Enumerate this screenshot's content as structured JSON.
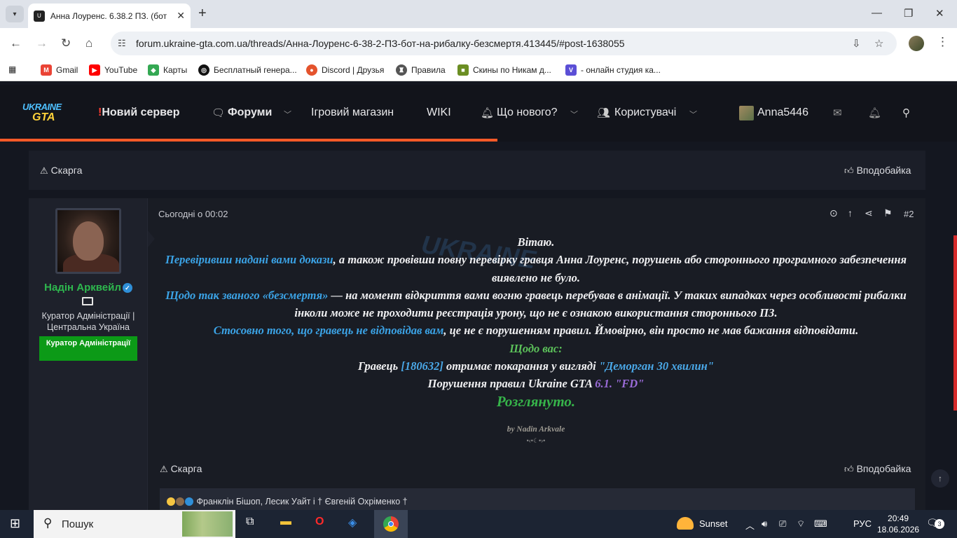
{
  "browser": {
    "tab_title": "Анна Лоуренс. 6.38.2 ПЗ. (бот",
    "url": "forum.ukraine-gta.com.ua/threads/Анна-Лоуренс-6-38-2-ПЗ-бот-на-рибалку-безсмертя.413445/#post-1638055",
    "bookmarks": [
      {
        "label": "Gmail",
        "color": "#ea4335",
        "icon": "gmail-icon"
      },
      {
        "label": "YouTube",
        "color": "#ff0000",
        "icon": "youtube-icon"
      },
      {
        "label": "Карты",
        "color": "#34a853",
        "icon": "maps-icon"
      },
      {
        "label": "Бесплатный генера...",
        "color": "#111111",
        "icon": "target-icon"
      },
      {
        "label": "Discord | Друзья",
        "color": "#e4532d",
        "icon": "discord-icon"
      },
      {
        "label": "Правила",
        "color": "#555555",
        "icon": "shield-icon"
      },
      {
        "label": "Скины по Никам д...",
        "color": "#6b8e23",
        "icon": "minecraft-icon"
      },
      {
        "label": "- онлайн студия ка...",
        "color": "#5b4fd6",
        "icon": "v-icon"
      }
    ]
  },
  "site": {
    "logo_top": "UKRAINE",
    "logo_bottom": "GTA",
    "nav": {
      "new_server_mark": "!",
      "new_server": "Новий сервер",
      "forums": "Форуми",
      "shop": "Ігровий магазин",
      "wiki": "WIKI",
      "whats_new": "Що нового?",
      "users": "Користувачі",
      "username": "Anna5446"
    },
    "progress_percent": 52,
    "accent_color": "#ff5a28"
  },
  "post_prev": {
    "report": "Скарга",
    "like": "Вподобайка"
  },
  "post": {
    "author": "Надін Арквейл",
    "author_title": "Куратор Адміністрації | Центральна Україна",
    "badge": "Куратор Адміністрації",
    "badge_color": "#0c9a17",
    "date": "Сьогодні о 00:02",
    "number": "#2",
    "lines": {
      "greeting": "Вітаю.",
      "p1_link": "Перевіривши надані вами докази",
      "p1_rest": ", а також провівши повну перевірку гравця Анна Лоуренс, порушень або стороннього програмного забезпечення виявлено не було.",
      "p2_link": "Щодо так званого «безсмертя»",
      "p2_rest": " — на момент відкриття вами вогню гравець перебував в анімації. У таких випадках через особливості рибалки інколи може не проходити реєстрація урону, що не є ознакою використання стороннього ПЗ.",
      "p3_link": "Стосовно того, що гравець не відповідав вам",
      "p3_rest": ", це не є порушенням правил. Ймовірно, він просто не мав бажання відповідати.",
      "about_you": "Щодо вас:",
      "p4_a": "Гравець ",
      "p4_id": "[180632]",
      "p4_b": " отримає покарання у вигляді ",
      "p4_pun": "\"Деморган 30 хвилин\"",
      "p5_a": "Порушення правил Ukraine GTA ",
      "p5_rule": "6.1. \"FD\"",
      "status": "Розглянуто."
    },
    "signature": "by Nadin Arkvale",
    "signature_deco": "•‹•☾•›•",
    "report": "Скарга",
    "like": "Вподобайка",
    "reactions_text": "Франклін Бішоп, Лесик Уайт і † Євгеній Охріменко †"
  },
  "taskbar": {
    "search": "Пошук",
    "weather": "Sunset",
    "lang": "РУС",
    "time": "20:49",
    "date": "18.06.2026",
    "notifications": "3"
  }
}
